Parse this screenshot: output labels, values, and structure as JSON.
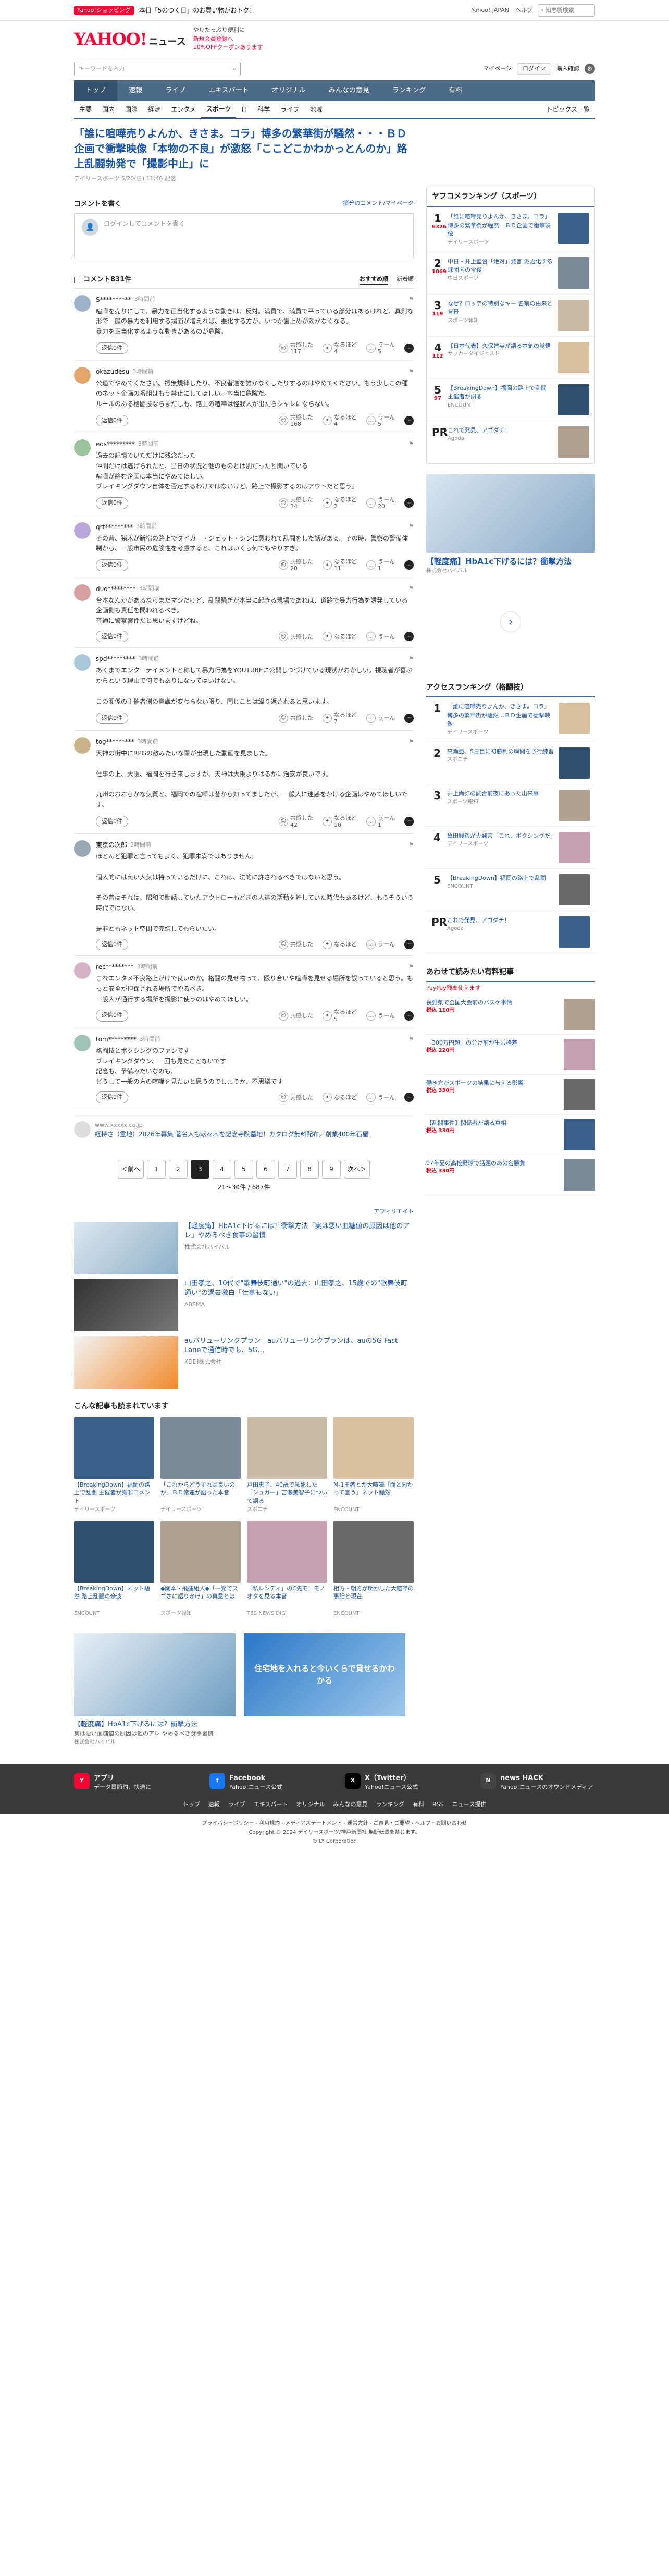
{
  "top": {
    "shop_badge": "Yahoo!ショッピング",
    "promo": "本日「5のつく日」のお買い物がおトク！",
    "links": [
      "Yahoo! JAPAN",
      "ヘルプ"
    ],
    "search_placeholder": "知恵袋検索"
  },
  "header": {
    "logo": "YAHOO!",
    "logo_sub": "ニュース",
    "tagline1": "やりたっぷり便利に",
    "tagline2": "新規会員登録へ",
    "tagline3": "10%OFFクーポンあります"
  },
  "search": {
    "placeholder": "キーワードを入力",
    "mypage": "マイページ",
    "login": "ログイン",
    "register": "購入確認"
  },
  "gnav": [
    "トップ",
    "速報",
    "ライブ",
    "エキスパート",
    "オリジナル",
    "みんなの意見",
    "ランキング",
    "有料"
  ],
  "subnav": [
    "主要",
    "国内",
    "国際",
    "経済",
    "エンタメ",
    "スポーツ",
    "IT",
    "科学",
    "ライフ",
    "地域"
  ],
  "subnav_topics": "トピックス一覧",
  "article": {
    "title": "「誰に喧嘩売りよんか、きさま。コラ」博多の繁華街が騒然・・・ＢＤ企画で衝撃映像「本物の不良」が激怒「ここどこかわかっとんのか」路上乱闘勃発で「撮影中止」に",
    "meta": "デイリースポーツ 5/20(日) 11:48 配信"
  },
  "comment_form": {
    "title": "コメントを書く",
    "policy": "癒分のコメント/マイページ",
    "placeholder": "ログインしてコメントを書く"
  },
  "clist": {
    "title": "コメント831件",
    "sort_rec": "おすすめ順",
    "sort_new": "新着順"
  },
  "comments": [
    {
      "user": "S**********",
      "time": "3時間前",
      "text": "喧嘩を売りにして、暴力を正当化するような動きは、反対。満員で、満員で平っている部分はあるけれど、真剣な形で一般の暴力を利用する場面が増えれば、悪化する方が、いつか歯止めが効かなくなる。\n暴力を正当化するような動きがあるのが危険。",
      "e": "共感した",
      "e_n": "117",
      "n": "なるほど",
      "n_n": "4",
      "u": "うーん",
      "u_n": "5"
    },
    {
      "user": "okazudesu",
      "time": "3時間前",
      "text": "公道でやめてください。振無規律したり、不良者達を誰かなくしたりするのはやめてください。もう少しこの種のネット企画の番組はもう禁止にしてほしい。本当に危険だ。\nルールのある格闘技ならまだしも、路上の喧嘩は怪我人が出たらシャレにならない。",
      "e": "共感した",
      "e_n": "168",
      "n": "なるほど",
      "n_n": "4",
      "u": "うーん",
      "u_n": "5"
    },
    {
      "user": "eos*********",
      "time": "3時間前",
      "text": "過去の記憶でいただけに残念だった\n仲間だけは逃げられたと、当日の状況と他のものとは別だったと聞いている\n喧嘩が絡む企画は本当にやめてほしい。\nブレイキングダウン自体を否定するわけではないけど、路上で撮影するのはアウトだと思う。",
      "e": "共感した",
      "e_n": "34",
      "n": "なるほど",
      "n_n": "2",
      "u": "うーん",
      "u_n": "20"
    },
    {
      "user": "qrt*********",
      "time": "3時間前",
      "text": "その昔、猪木が新宿の路上でタイガー・ジェット・シンに襲われて乱闘をした話がある。その時、警察の警備体制から、一般市民の危険性を考慮すると、これはいくら何でもやりすぎ。",
      "e": "共感した",
      "e_n": "20",
      "n": "なるほど",
      "n_n": "11",
      "u": "うーん",
      "u_n": "1"
    },
    {
      "user": "duo*********",
      "time": "3時間前",
      "text": "台本なんかがあるならまだマシだけど、乱闘騒ぎが本当に起きる現場であれば、道路で暴力行為を誘発している企画側も責任を問われるべき。\n普通に警察案件だと思いますけどね。",
      "e": "共感した",
      "e_n": "",
      "n": "なるほど",
      "n_n": "",
      "u": "うーん",
      "u_n": ""
    },
    {
      "user": "spd*********",
      "time": "3時間前",
      "text": "あくまでエンターテイメントと称して暴力行為をYOUTUBEに公開しつづけている現状がおかしい。視聴者が喜ぶからという理由で何でもありになってはいけない。\n\nこの関係の主催者側の意識が変わらない限り、同じことは繰り返されると思います。",
      "e": "共感した",
      "e_n": "",
      "n": "なるほど",
      "n_n": "7",
      "u": "うーん",
      "u_n": ""
    },
    {
      "user": "tog*********",
      "time": "3時間前",
      "text": "天神の街中にRPGの敵みたいな輩が出現した動画を見ました。\n\n仕事の上、大阪、福岡を行き来しますが、天神は大阪よりはるかに治安が良いです。\n\n九州のおおらかな気質と、福岡での喧嘩は昔から知ってましたが、一般人に迷惑をかける企画はやめてほしいです。",
      "e": "共感した",
      "e_n": "42",
      "n": "なるほど",
      "n_n": "10",
      "u": "うーん",
      "u_n": "1"
    },
    {
      "user": "東京の次郎",
      "time": "3時間前",
      "text": "ほとんど犯罪と言ってもよく、犯罪未満ではありません。\n\n個人的にはえい人気は持っているだけに、これは、法的に許されるべきではないと思う。\n\nその昔はそれは、昭和で勧誘していたアウトローもどきの人達の活動を許していた時代もあるけど、もうそういう時代ではない。\n\n是非ともネット空間で完結してもらいたい。",
      "e": "共感した",
      "e_n": "",
      "n": "なるほど",
      "n_n": "",
      "u": "うーん",
      "u_n": ""
    },
    {
      "user": "rec*********",
      "time": "3時間前",
      "text": "これエンタメ不良路上がけで良いのか。格闘の見せ物って、殴り合いや喧嘩を見せる場所を誤っていると思う。もっと安全が担保される場所でやるべき。\n一般人が通行する場所を撮影に使うのはやめてほしい。",
      "e": "共感した",
      "e_n": "",
      "n": "なるほど",
      "n_n": "5",
      "u": "うーん",
      "u_n": ""
    },
    {
      "user": "tom*********",
      "time": "3時間前",
      "text": "格闘技とボクシングのファンです\nブレイキングダウン、一回も見たことないです\n記念も、予備みたいなのも、\nどうして一般の方の喧嘩を見たいと思うのでしょうか、不思議です",
      "e": "共感した",
      "e_n": "",
      "n": "なるほど",
      "n_n": "",
      "u": "うーん",
      "u_n": ""
    }
  ],
  "comment_reply": "返信0件",
  "adlink": {
    "src": "www.xxxxx.co.jp",
    "title": "経持さ（霊地）2026年募集 著名人も転々木を記念寺院墓地！カタログ無料配布／創業400年石屋"
  },
  "pager": {
    "prev": "＜前へ",
    "pages": [
      "1",
      "2",
      "3",
      "4",
      "5",
      "6",
      "7",
      "8",
      "9"
    ],
    "current": "3",
    "next": "次へ＞",
    "count": "21〜30件 / 687件"
  },
  "ads": {
    "label": "アフィリエイト",
    "items": [
      {
        "title": "【軽度痛】HbA1c下げるには？衝撃方法「実は悪い血糖値の原因は他のアレ」やめるべき食事の習慣",
        "src": "株式会社ハイバル"
      },
      {
        "title": "山田孝之、10代で\"歌舞伎町通い\"の過去：山田孝之、15歳での\"歌舞伎町通い\"の過去激白「仕事もない」",
        "src": "ABEMA"
      },
      {
        "title": "auバリューリンクプラン｜auバリューリンクプランは、auの5G Fast Laneで通信時でも、5G…",
        "src": "KDDI株式会社"
      }
    ]
  },
  "reads": {
    "title": "こんな記事も読まれています",
    "items": [
      {
        "t": "【BreakingDown】福岡の路上で乱闘 主催者が謝罪コメント",
        "s": "デイリースポーツ"
      },
      {
        "t": "「これからどうすれば良いのか」ＢＤ常連が語った本音",
        "s": "デイリースポーツ"
      },
      {
        "t": "戸田恵子、40歳で急死した「シュガー」吉瀬美智子について語る",
        "s": "スポニチ"
      },
      {
        "t": "M-1王者とが大喧嘩「面と向かって言う」ネット騒然",
        "s": "ENCOUNT"
      },
      {
        "t": "【BreakingDown】ネット騒然 路上乱闘の余波",
        "s": "ENCOUNT"
      },
      {
        "t": "◆関本・飛蓮組人◆「一発でスゴさに語りかけ」の真意とは",
        "s": "スポーツ報知"
      },
      {
        "t": "「私レンディ」のC先モ！モノオタを見る本音",
        "s": "TBS NEWS DIG"
      },
      {
        "t": "相方・朝方が明かした大喧嘩の裏話と現在",
        "s": "ENCOUNT"
      }
    ]
  },
  "bottom_ads": [
    {
      "t": "【軽度痛】HbA1c下げるには？衝撃方法",
      "s": "株式会社ハイバル",
      "d": "実は悪い血糖値の原因は他のアレ やめるべき食事習慣"
    },
    {
      "t": "住宅地を入れると今いくらで貸せるかわかる",
      "s": "",
      "d": ""
    }
  ],
  "side": {
    "rank_title": "ヤフコメランキング（スポーツ）",
    "rank": [
      {
        "n": "1",
        "c": "6326",
        "t": "「誰に喧嘩売りよんか、きさま。コラ」博多の繁華街が騒然…ＢＤ企画で衝撃映像",
        "s": "デイリースポーツ"
      },
      {
        "n": "2",
        "c": "1069",
        "t": "中日・井上監督「絶対」発言 泥沼化する球団内の今後",
        "s": "中日スポーツ"
      },
      {
        "n": "3",
        "c": "119",
        "t": "なぜ？ロッテの特別なキー 名前の由来と背景",
        "s": "スポーツ報知"
      },
      {
        "n": "4",
        "c": "112",
        "t": "【日本代表】久保建英が語る本気の覚悟",
        "s": "サッカーダイジェスト"
      },
      {
        "n": "5",
        "c": "97",
        "t": "【BreakingDown】福岡の路上で乱闘 主催者が謝罪",
        "s": "ENCOUNT"
      },
      {
        "n": "PR",
        "c": "",
        "t": "これで発見、アゴダチ！",
        "s": "Agoda"
      }
    ],
    "ad_title": "【軽度痛】HbA1c下げるには？衝撃方法",
    "ad_src": "株式会社ハイバル",
    "access_title": "アクセスランキング（格闘技）",
    "access": [
      {
        "n": "1",
        "t": "「誰に喧嘩売りよんか、きさま。コラ」博多の繁華街が騒然…ＢＤ企画で衝撃映像",
        "s": "デイリースポーツ"
      },
      {
        "n": "2",
        "t": "高瀬亜、5日目に初勝利の瞬間を予行練習",
        "s": "スポニチ"
      },
      {
        "n": "3",
        "t": "井上尚弥の試合前夜にあった出来事",
        "s": "スポーツ報知"
      },
      {
        "n": "4",
        "t": "亀田興毅が大発言「これ、ボクシングだ」",
        "s": "デイリースポーツ"
      },
      {
        "n": "5",
        "t": "【BreakingDown】福岡の路上で乱闘",
        "s": "ENCOUNT"
      },
      {
        "n": "PR",
        "t": "これで発見、アゴダチ！",
        "s": "Agoda"
      }
    ],
    "mag_title": "あわせて読みたい有料記事",
    "mag_sub": "PayPay残高使えます",
    "mags": [
      {
        "t": "長野県で全国大会前のバスケ事情",
        "p": "税込 110円"
      },
      {
        "t": "「300万円超」の分け前が生む格差",
        "p": "税込 220円"
      },
      {
        "t": "働き方がスポーツの結果に与える影響",
        "p": "税込 330円"
      },
      {
        "t": "【乱闘事件】関係者が語る真相",
        "p": "税込 330円"
      },
      {
        "t": "07年夏の高校野球で話題のあの名勝負",
        "p": "税込 330円"
      }
    ]
  },
  "footer": {
    "apps": [
      {
        "t": "アプリ",
        "d": "データ量節約、快適に",
        "i": "Y"
      },
      {
        "t": "Facebook",
        "d": "Yahoo!ニュース公式",
        "i": "f"
      },
      {
        "t": "X（Twitter）",
        "d": "Yahoo!ニュース公式",
        "i": "X"
      },
      {
        "t": "news HACK",
        "d": "Yahoo!ニュースのオウンドメディア",
        "i": "N"
      }
    ],
    "links": [
      "トップ",
      "速報",
      "ライブ",
      "エキスパート",
      "オリジナル",
      "みんなの意見",
      "ランキング",
      "有料",
      "RSS",
      "ニュース提供"
    ],
    "line1": "プライバシーポリシー - 利用規約 - メディアステートメント - 運営方針 - ご意見・ご要望 - ヘルプ・お問い合わせ",
    "line2": "Copyright © 2024 デイリースポーツ/神戸新聞社 無断転載を禁じます。",
    "line3": "© LY Corporation"
  },
  "colors": {
    "nav": "#4a6a86",
    "brand": "#ff0033",
    "link": "#1a56a6"
  }
}
